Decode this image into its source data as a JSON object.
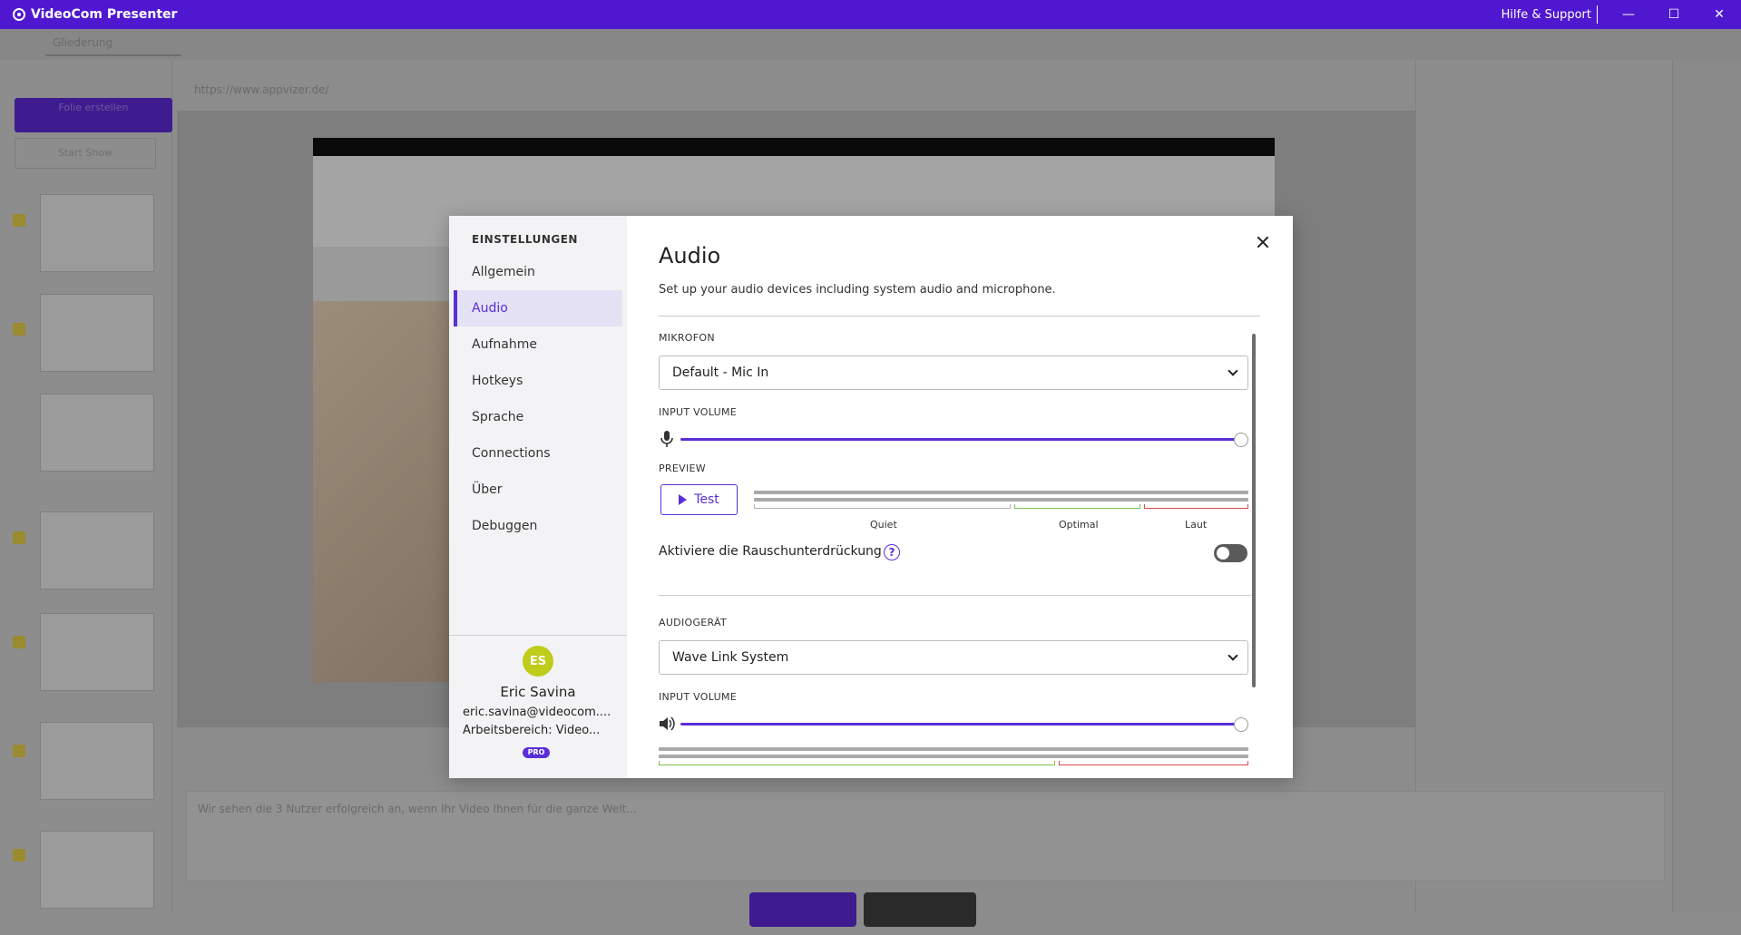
{
  "titlebar": {
    "app_title": "VideoCom Presenter",
    "help_link": "Hilfe & Support",
    "minimize_glyph": "—",
    "maximize_glyph": "☐",
    "close_glyph": "✕",
    "bg_color": "#4f18d0"
  },
  "background": {
    "tab_label": "Gliederung",
    "new_slide_label": "Folie erstellen",
    "start_show_label": "Start Show",
    "url": "https://www.appvizer.de/",
    "notes_placeholder": "Wir sehen die 3 Nutzer erfolgreich an, wenn Ihr Video Ihnen für die ganze Welt..."
  },
  "settings": {
    "nav_heading": "EINSTELLUNGEN",
    "nav_items": [
      {
        "label": "Allgemein",
        "active": false
      },
      {
        "label": "Audio",
        "active": true
      },
      {
        "label": "Aufnahme",
        "active": false
      },
      {
        "label": "Hotkeys",
        "active": false
      },
      {
        "label": "Sprache",
        "active": false
      },
      {
        "label": "Connections",
        "active": false
      },
      {
        "label": "Über",
        "active": false
      },
      {
        "label": "Debuggen",
        "active": false
      }
    ],
    "user": {
      "initials": "ES",
      "name": "Eric Savina",
      "email": "eric.savina@videocom....",
      "workspace": "Arbeitsbereich: Video...",
      "badge": "PRO"
    }
  },
  "audio": {
    "title": "Audio",
    "subtitle": "Set up your audio devices including system audio and microphone.",
    "microphone": {
      "section_label": "MIKROFON",
      "device": "Default - Mic In",
      "input_volume_label": "INPUT VOLUME",
      "input_volume_level": 1.0,
      "preview_label": "PREVIEW",
      "test_button": "Test",
      "ranges": [
        "Quiet",
        "Optimal",
        "Laut"
      ],
      "noise_suppression_label": "Aktiviere die Rauschunterdrückung",
      "help_glyph": "?",
      "noise_suppression_on": false
    },
    "audio_device": {
      "section_label": "AUDIOGERÄT",
      "device": "Wave Link System",
      "input_volume_label": "INPUT VOLUME",
      "input_volume_level": 1.0
    }
  },
  "colors": {
    "accent": "#5a2fd8",
    "quiet": "#b0b0b0",
    "optimal": "#7cc04a",
    "loud": "#d94b4b"
  }
}
